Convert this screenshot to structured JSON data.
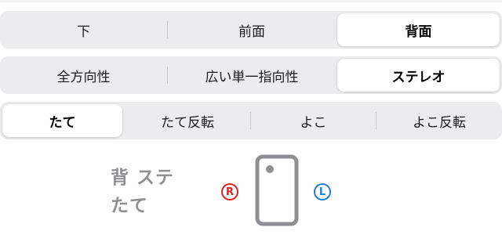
{
  "theme": {
    "channel_right_color": "#e02020",
    "channel_left_color": "#1a7fe0",
    "phone_color": "#8e8e93"
  },
  "microphone_position": {
    "options": [
      "下",
      "前面",
      "背面"
    ],
    "selected": "背面"
  },
  "directivity": {
    "options": [
      "全方向性",
      "広い単一指向性",
      "ステレオ"
    ],
    "selected": "ステレオ"
  },
  "orientation": {
    "options": [
      "たて",
      "たて反転",
      "よこ",
      "よこ反転"
    ],
    "selected": "たて"
  },
  "status": {
    "line1": "背 ステ",
    "line2": "たて",
    "right_channel": "R",
    "left_channel": "L",
    "phone_icon": "phone-portrait-back-icon"
  }
}
